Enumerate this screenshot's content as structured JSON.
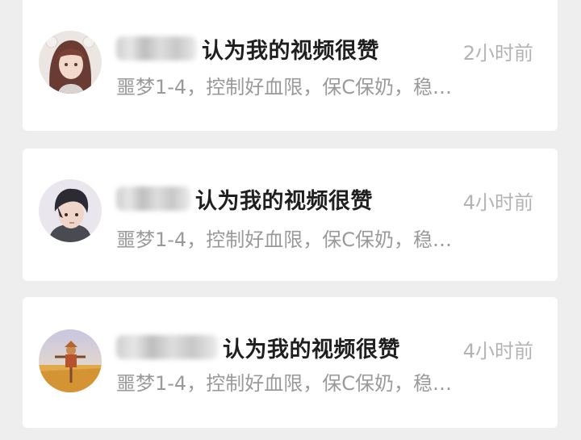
{
  "notifications": [
    {
      "sender_name_obscured": true,
      "action_text": "认为我的视频很赞",
      "time": "2小时前",
      "preview": "噩梦1-4，控制好血限，保C保奶，稳…",
      "avatar_icon": "anime-girl-avatar"
    },
    {
      "sender_name_obscured": true,
      "action_text": "认为我的视频很赞",
      "time": "4小时前",
      "preview": "噩梦1-4，控制好血限，保C保奶，稳…",
      "avatar_icon": "anime-boy-avatar"
    },
    {
      "sender_name_obscured": true,
      "action_text": "认为我的视频很赞",
      "time": "4小时前",
      "preview": "噩梦1-4，控制好血限，保C保奶，稳…",
      "avatar_icon": "scarecrow-field-avatar"
    }
  ],
  "colors": {
    "background": "#eeeeee",
    "card": "#ffffff",
    "title": "#1f1f1f",
    "preview": "#9a9a9a",
    "time": "#b3b3b3"
  }
}
